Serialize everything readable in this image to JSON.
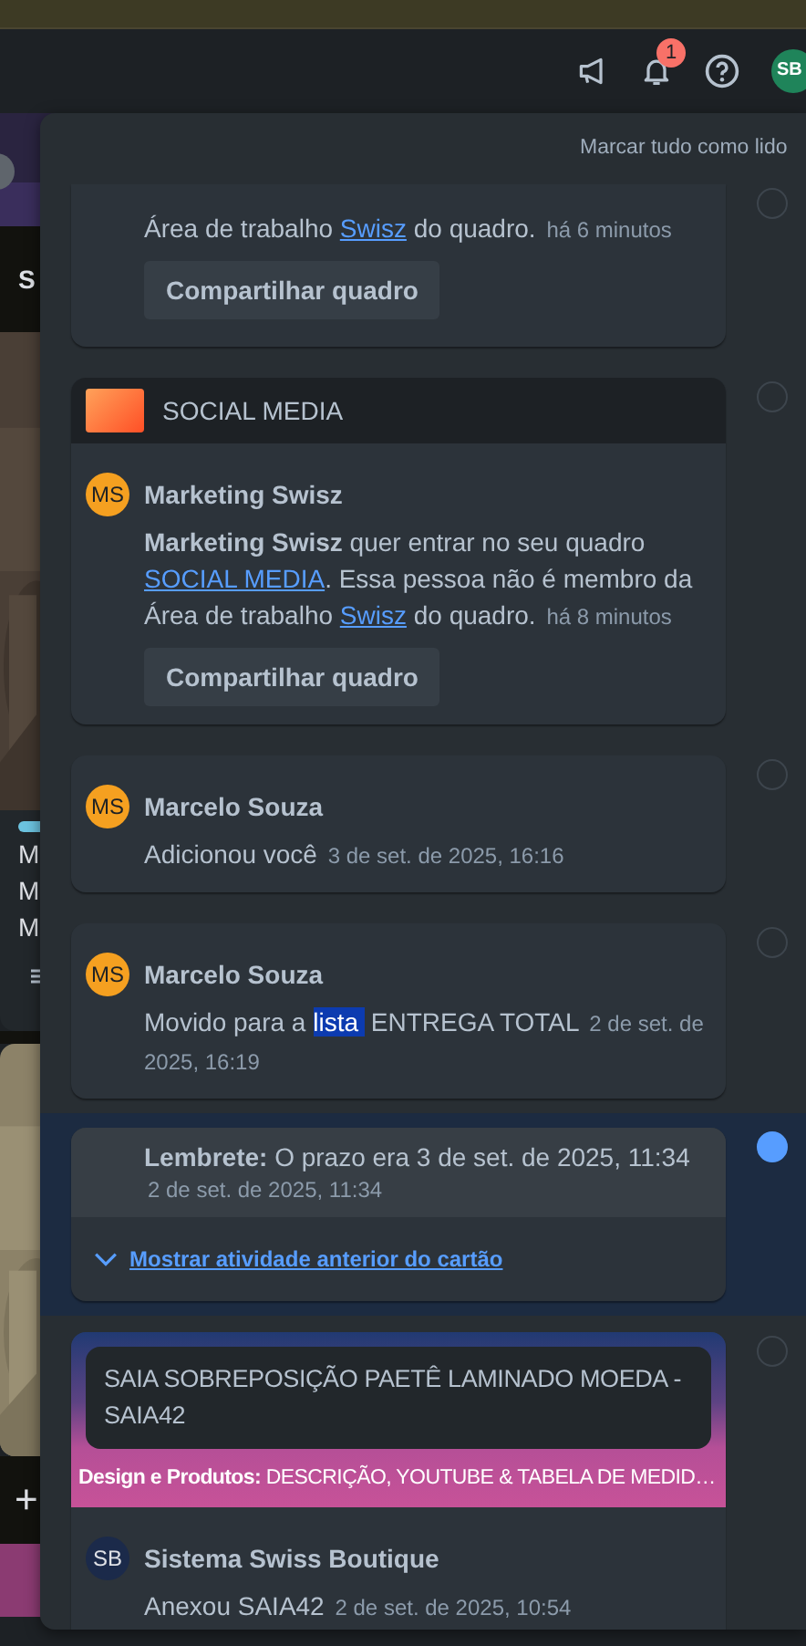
{
  "header": {
    "notification_badge": "1",
    "avatar": "SB"
  },
  "board": {
    "list_title": "S",
    "card_lines": [
      "M",
      "M",
      "M"
    ],
    "add_button": "+"
  },
  "notifications_panel": {
    "mark_all_read": "Marcar tudo como lido",
    "notifications": [
      {
        "kind": "activity",
        "read": true,
        "body": [
          {
            "text": "Área de trabalho "
          },
          {
            "text": "Swisz",
            "link": true
          },
          {
            "text": " do quadro."
          }
        ],
        "time": "há 6 minutos",
        "button": "Compartilhar quadro"
      },
      {
        "kind": "activity",
        "read": true,
        "board": {
          "title": "SOCIAL MEDIA"
        },
        "author": {
          "initials": "MS",
          "name": "Marketing Swisz",
          "color": "#f5a020"
        },
        "body": [
          {
            "text": "**Marketing Swisz** quer entrar no seu quadro "
          },
          {
            "text": "SOCIAL MEDIA",
            "link": true
          },
          {
            "text": ". Essa pessoa não é membro da Área de trabalho "
          },
          {
            "text": "Swisz",
            "link": true
          },
          {
            "text": " do quadro."
          }
        ],
        "time": "há 8 minutos",
        "button": "Compartilhar quadro"
      },
      {
        "kind": "activity",
        "read": true,
        "author": {
          "initials": "MS",
          "name": "Marcelo Souza",
          "color": "#f5a020"
        },
        "body": [
          {
            "text": "Adicionou você"
          }
        ],
        "time": "3 de set. de 2025, 16:16"
      },
      {
        "kind": "activity",
        "read": true,
        "author": {
          "initials": "MS",
          "name": "Marcelo Souza",
          "color": "#f5a020"
        },
        "body": [
          {
            "text": "Movido para a "
          },
          {
            "text": "lista",
            "highlighted": true
          },
          {
            "text": " ENTREGA TOTAL"
          }
        ],
        "time": "2 de set. de 2025, 16:19"
      },
      {
        "kind": "reminder",
        "read": false,
        "body": [
          {
            "text": "**Lembrete:** O prazo era 3 de set. de 2025, 11:34"
          }
        ],
        "time": "2 de set. de 2025, 11:34",
        "expand_link": "Mostrar atividade anterior do cartão"
      },
      {
        "kind": "activity",
        "read": true,
        "card": {
          "title": "SAIA SOBREPOSIÇÃO PAETÊ LAMINADO MOEDA - SAIA42",
          "breadcrumb": "**Design e Produtos:** DESCRIÇÃO, YOUTUBE & TABELA DE MEDID…"
        },
        "author": {
          "initials": "SB",
          "name": "Sistema Swiss Boutique",
          "color": "#1b2a4a"
        },
        "body": [
          {
            "text": "Anexou SAIA42"
          }
        ],
        "time": "2 de set. de 2025, 10:54"
      }
    ]
  }
}
